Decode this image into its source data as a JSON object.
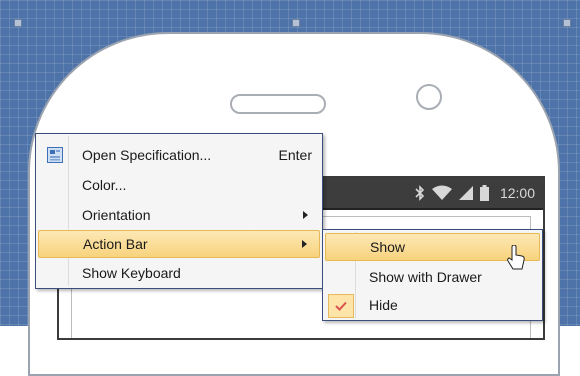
{
  "status_bar": {
    "time": "12:00"
  },
  "context_menu": {
    "items": [
      {
        "label": "Open Specification...",
        "shortcut": "Enter",
        "icon": "specification-icon"
      },
      {
        "label": "Color..."
      },
      {
        "label": "Orientation",
        "submenu": true
      },
      {
        "label": "Action Bar",
        "submenu": true,
        "highlighted": true
      },
      {
        "label": "Show Keyboard"
      }
    ]
  },
  "action_bar_submenu": {
    "items": [
      {
        "label": "Show",
        "highlighted": true
      },
      {
        "label": "Show with Drawer"
      },
      {
        "label": "Hide",
        "checked": true
      }
    ]
  },
  "colors": {
    "canvas_background": "#4d73a8",
    "menu_highlight": "#f8d37d",
    "menu_border": "#3c4f7c",
    "check_color": "#d9534f"
  }
}
